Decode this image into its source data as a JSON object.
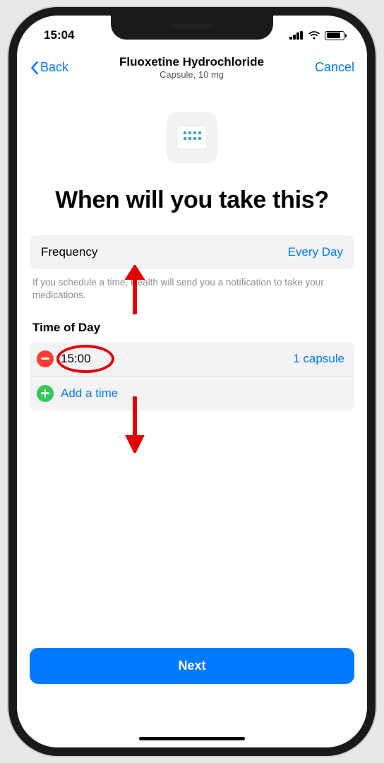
{
  "status": {
    "time": "15:04"
  },
  "nav": {
    "back": "Back",
    "title": "Fluoxetine Hydrochloride",
    "subtitle": "Capsule, 10 mg",
    "cancel": "Cancel"
  },
  "heading": "When will you take this?",
  "frequency": {
    "label": "Frequency",
    "value": "Every Day"
  },
  "hint": "If you schedule a time, Health will send you a notification to take your medications.",
  "timeSection": {
    "label": "Time of Day"
  },
  "times": [
    {
      "value": "15:00",
      "dose": "1 capsule"
    }
  ],
  "addTime": "Add a time",
  "nextButton": "Next"
}
